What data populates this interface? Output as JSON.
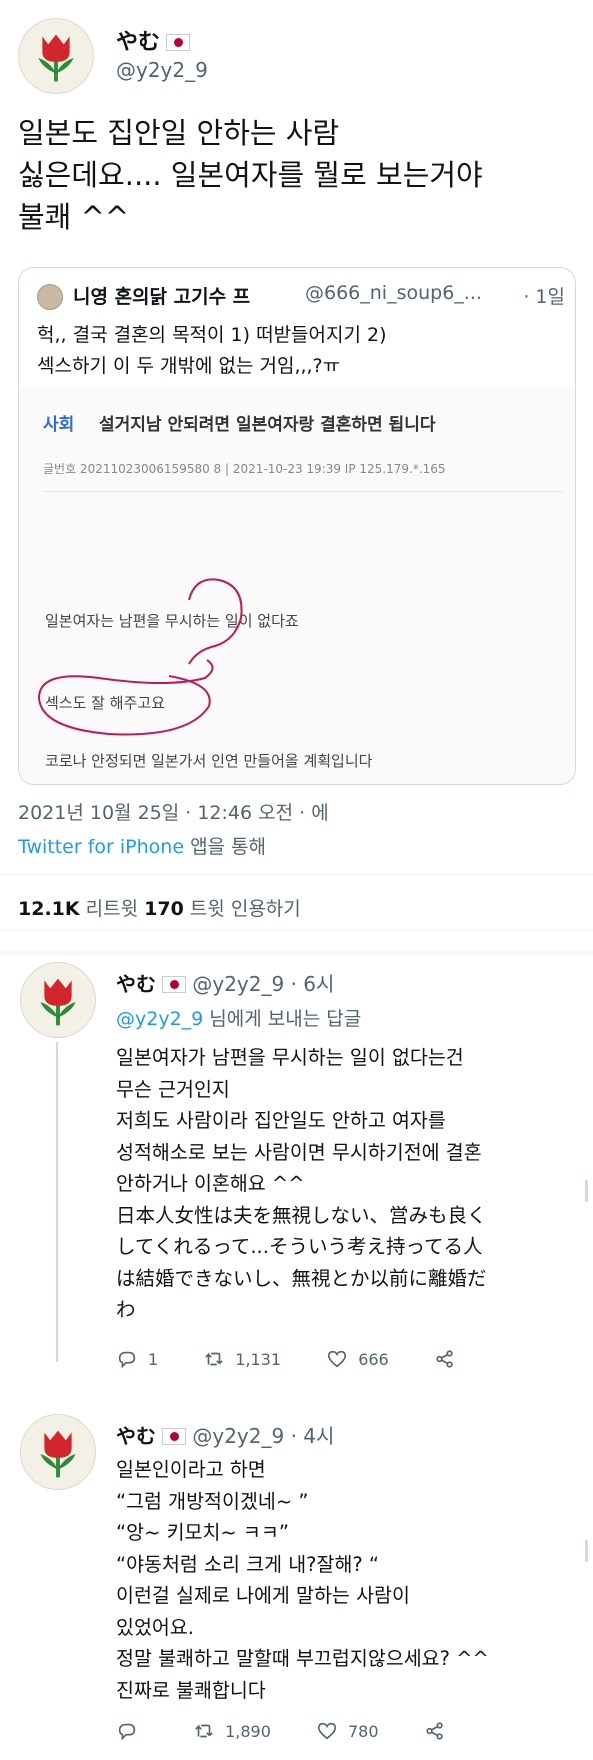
{
  "main_tweet": {
    "name": "やむ",
    "handle": "@y2y2_9",
    "text": "일본도 집안일 안하는 사람\n싫은데요.... 일본여자를 뭘로 보는거야\n불쾌 ^^",
    "quote": {
      "name": "니영 혼의닭 고기수 프",
      "handle": "@666_ni_soup6_...",
      "time": "· 1일",
      "text": "헉,, 결국 결혼의 목적이 1) 떠받들어지기 2)\n섹스하기 이 두 개밖에 없는 거임,,,?ㅠ",
      "article": {
        "category": "사회",
        "title": "설거지남 안되려면 일본여자랑 결혼하면 됩니다",
        "meta": "글번호  20211023006159580 8 | 2021-10-23 19:39     IP 125.179.*.165",
        "line1": "일본여자는 남편을 무시하는 일이 없다죠",
        "line2": "섹스도 잘 해주고요",
        "line3": "코로나 안정되면 일본가서 인연 만들어올 계획입니다"
      }
    },
    "date": "2021년 10월 25일 · 12:46 오전 · 에",
    "source_app": "Twitter for iPhone",
    "source_suffix": " 앱을 통해",
    "retweets": "12.1K",
    "retweets_label": " 리트윗   ",
    "quotes": "170",
    "quotes_label": " 트윗 인용하기"
  },
  "replies": [
    {
      "name": "やむ",
      "handle": "@y2y2_9 · 6시",
      "reply_to_mention": "@y2y2_9",
      "reply_to_suffix": " 님에게 보내는 답글",
      "text": "일본여자가 남편을 무시하는 일이 없다는건\n무슨 근거인지\n저희도 사람이라 집안일도 안하고 여자를\n성적해소로 보는 사람이면 무시하기전에 결혼\n안하거나 이혼해요 ^^\n日本人女性は夫を無視しない、営みも良く\nしてくれるって...そういう考え持ってる人\nは結婚できないし、無視とか以前に離婚だ\nわ",
      "replies_count": "1",
      "retweets_count": "1,131",
      "likes_count": "666"
    },
    {
      "name": "やむ",
      "handle": "@y2y2_9 · 4시",
      "text": "일본인이라고 하면\n“그럼 개방적이겠네~ ”\n“앙~ 키모치~ ㅋㅋ”\n“야동처럼 소리 크게 내?잘해? “\n이런걸 실제로 나에게 말하는 사람이\n있었어요.\n정말 불쾌하고 말할때 부끄럽지않으세요? ^^\n진짜로 불쾌합니다",
      "replies_count": "",
      "retweets_count": "1,890",
      "likes_count": "780"
    }
  ]
}
